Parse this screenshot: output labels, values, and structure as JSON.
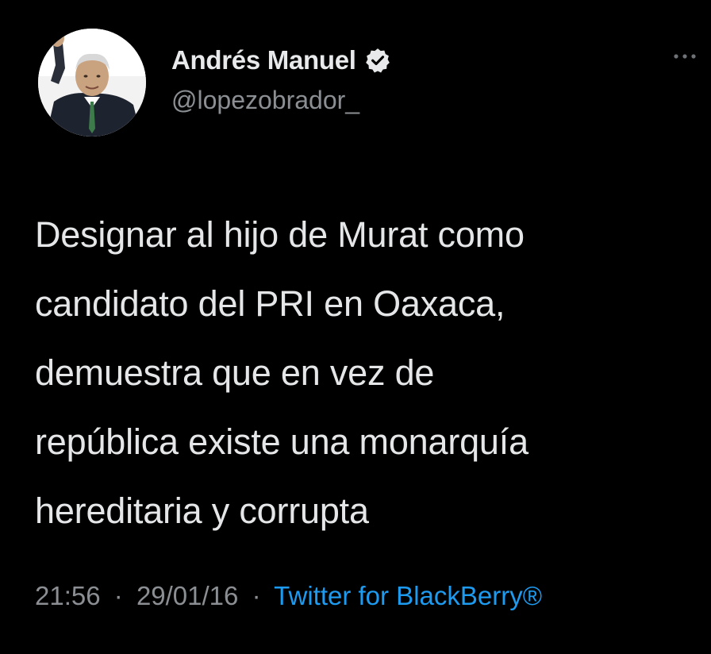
{
  "user": {
    "display_name": "Andrés Manuel",
    "handle": "@lopezobrador_",
    "verified": true,
    "avatar_icon": "profile-photo",
    "verified_icon": "verified-badge-icon"
  },
  "tweet": {
    "lines": [
      "Designar al hijo de Murat como",
      "candidato del PRI en Oaxaca,",
      "demuestra que en vez de",
      "república existe una monarquía",
      "hereditaria y corrupta"
    ]
  },
  "meta": {
    "time": "21:56",
    "separator": "·",
    "date": "29/01/16",
    "source": "Twitter for BlackBerry®"
  },
  "icons": {
    "more": "more-options-icon"
  },
  "colors": {
    "background": "#000000",
    "text": "#e7e9ea",
    "secondary": "#8b8f93",
    "link": "#1d9bf0"
  }
}
